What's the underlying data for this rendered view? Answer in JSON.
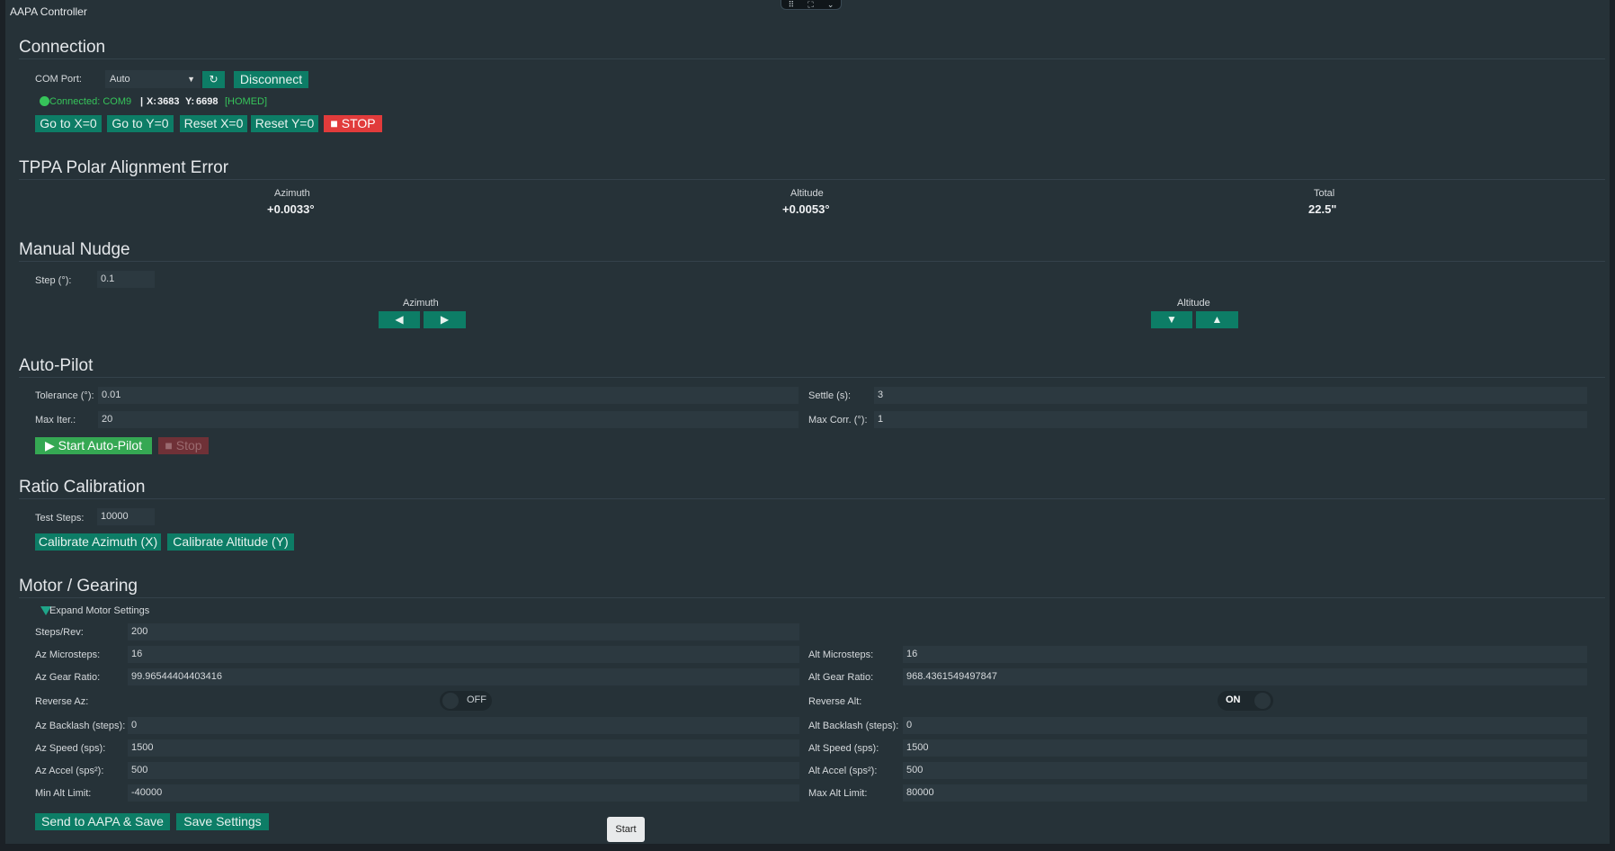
{
  "window": {
    "title": "AAPA Controller",
    "controls": [
      "⠿",
      "⛶",
      "⌄"
    ]
  },
  "connection": {
    "title": "Connection",
    "com_port_label": "COM Port:",
    "com_port_value": "Auto",
    "refresh_label": "↻",
    "disconnect_label": "Disconnect",
    "status_text": "Connected: COM9",
    "pos_sep": "|",
    "x_label": "X:",
    "x_value": "3683",
    "y_label": "Y:",
    "y_value": "6698",
    "homed": "[HOMED]",
    "go_x0": "Go to X=0",
    "go_y0": "Go to Y=0",
    "reset_x0": "Reset X=0",
    "reset_y0": "Reset Y=0",
    "stop_icon": "■",
    "stop_label": "STOP"
  },
  "tppa": {
    "title": "TPPA Polar Alignment Error",
    "azimuth_label": "Azimuth",
    "azimuth_value": "+0.0033°",
    "altitude_label": "Altitude",
    "altitude_value": "+0.0053°",
    "total_label": "Total",
    "total_value": "22.5\""
  },
  "nudge": {
    "title": "Manual Nudge",
    "step_label": "Step (°):",
    "step_value": "0.1",
    "azimuth_label": "Azimuth",
    "altitude_label": "Altitude",
    "left_arrow": "◀",
    "right_arrow": "▶",
    "down_arrow": "▼",
    "up_arrow": "▲"
  },
  "autopilot": {
    "title": "Auto-Pilot",
    "tolerance_label": "Tolerance (°):",
    "tolerance_value": "0.01",
    "settle_label": "Settle (s):",
    "settle_value": "3",
    "maxiter_label": "Max Iter.:",
    "maxiter_value": "20",
    "maxcorr_label": "Max Corr. (°):",
    "maxcorr_value": "1",
    "start_label": "▶ Start Auto-Pilot",
    "stop_label": "■ Stop"
  },
  "ratio": {
    "title": "Ratio Calibration",
    "test_steps_label": "Test Steps:",
    "test_steps_value": "10000",
    "cal_az_label": "Calibrate Azimuth (X)",
    "cal_alt_label": "Calibrate Altitude (Y)"
  },
  "motor": {
    "title": "Motor / Gearing",
    "expand_label": "Expand Motor Settings",
    "steps_rev_label": "Steps/Rev:",
    "steps_rev_value": "200",
    "az_micro_label": "Az Microsteps:",
    "az_micro_value": "16",
    "alt_micro_label": "Alt Microsteps:",
    "alt_micro_value": "16",
    "az_gear_label": "Az Gear Ratio:",
    "az_gear_value": "99.96544404403416",
    "alt_gear_label": "Alt Gear Ratio:",
    "alt_gear_value": "968.4361549497847",
    "rev_az_label": "Reverse Az:",
    "rev_az_state": "OFF",
    "rev_alt_label": "Reverse Alt:",
    "rev_alt_state": "ON",
    "az_backlash_label": "Az Backlash (steps):",
    "az_backlash_value": "0",
    "alt_backlash_label": "Alt Backlash (steps):",
    "alt_backlash_value": "0",
    "az_speed_label": "Az Speed (sps):",
    "az_speed_value": "1500",
    "alt_speed_label": "Alt Speed (sps):",
    "alt_speed_value": "1500",
    "az_accel_label": "Az Accel (sps²):",
    "az_accel_value": "500",
    "alt_accel_label": "Alt Accel (sps²):",
    "alt_accel_value": "500",
    "min_alt_label": "Min Alt Limit:",
    "min_alt_value": "-40000",
    "max_alt_label": "Max Alt Limit:",
    "max_alt_value": "80000",
    "send_label": "Send to AAPA & Save",
    "save_label": "Save Settings"
  },
  "start_popup": "Start",
  "colors": {
    "accent": "#0d7d66",
    "stop": "#e13b3b",
    "start_green": "#35a853",
    "background": "#263238"
  }
}
